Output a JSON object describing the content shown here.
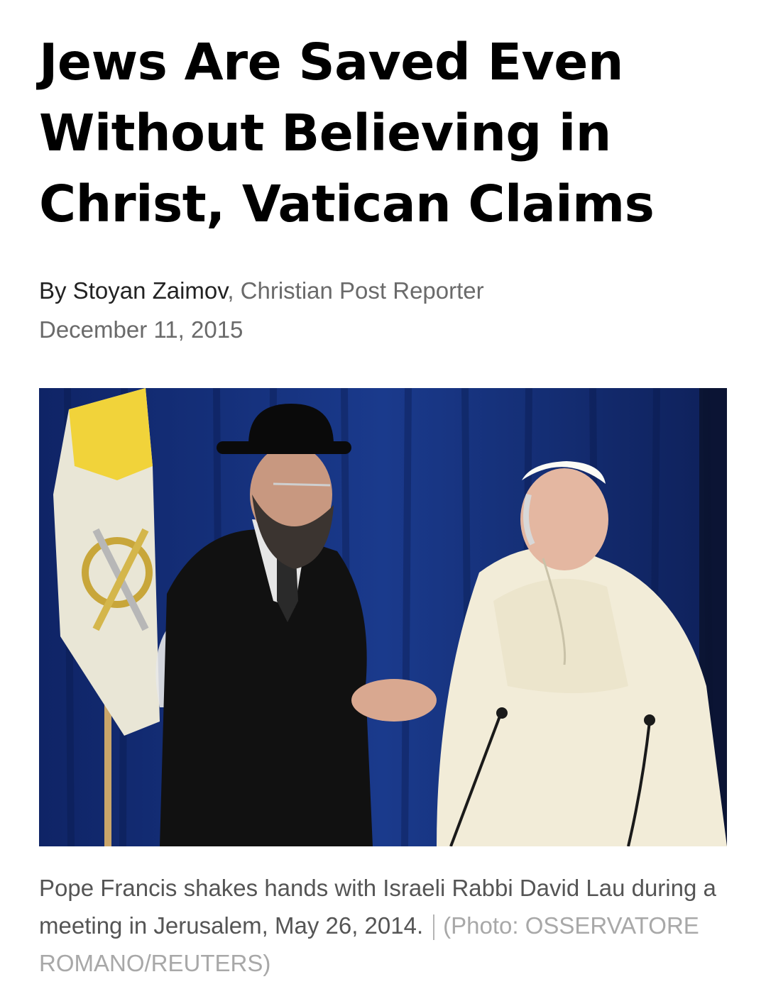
{
  "article": {
    "headline": "Jews Are Saved Even Without Believing in Christ, Vatican Claims",
    "author": "By Stoyan Zaimov",
    "author_role": ", Christian Post Reporter",
    "date": "December 11, 2015"
  },
  "photo": {
    "caption": "Pope Francis shakes hands with Israeli Rabbi David Lau during a meeting in Jerusalem, May 26, 2014.",
    "credit": "(Photo: OSSERVATORE ROMANO/REUTERS)"
  }
}
